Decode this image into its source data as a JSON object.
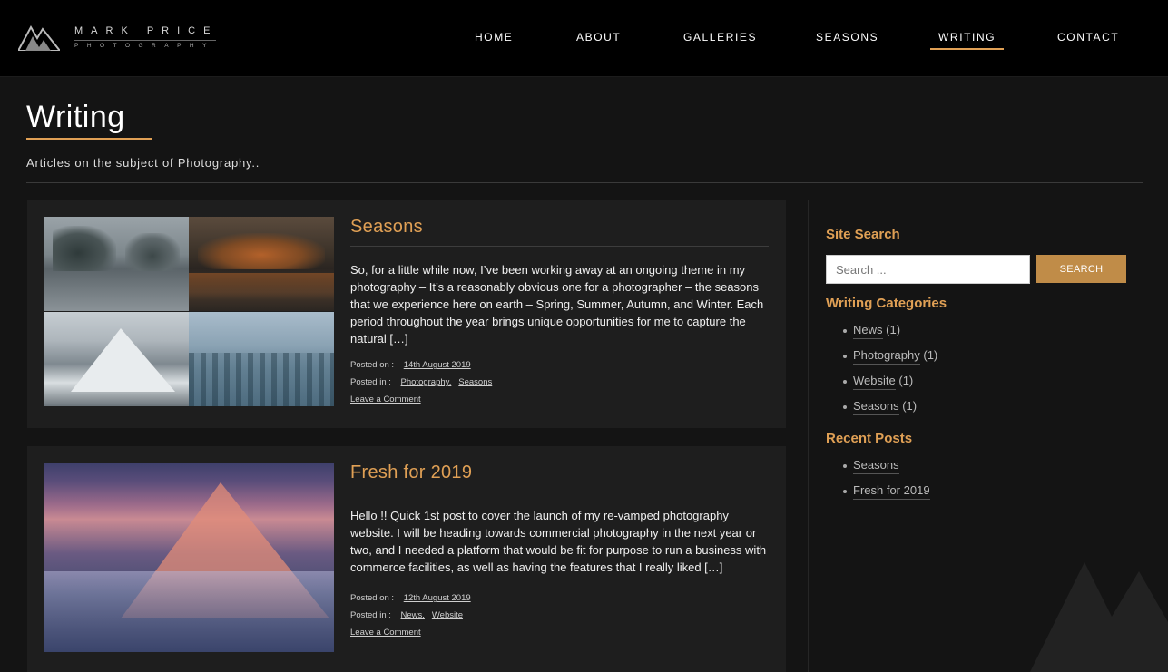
{
  "brand": {
    "name_line1": "MARK PRICE",
    "name_line2": "PHOTOGRAPHY"
  },
  "nav": {
    "items": [
      {
        "label": "HOME"
      },
      {
        "label": "ABOUT"
      },
      {
        "label": "GALLERIES"
      },
      {
        "label": "SEASONS"
      },
      {
        "label": "WRITING"
      },
      {
        "label": "CONTACT"
      }
    ],
    "active": "WRITING"
  },
  "page": {
    "title": "Writing",
    "subtitle": "Articles on the subject of Photography.."
  },
  "posts": [
    {
      "title": "Seasons",
      "excerpt": "So, for a little while now, I’ve been working away at an ongoing theme in my photography – It’s a reasonably obvious one for a photographer – the seasons that we experience here on earth – Spring, Summer, Autumn, and Winter. Each period throughout the year brings unique opportunities for me to capture the natural […]",
      "posted_on_label": "Posted on :",
      "date": "14th August 2019",
      "posted_in_label": "Posted in :",
      "categories": [
        "Photography,",
        "Seasons"
      ],
      "comment_link": "Leave a Comment"
    },
    {
      "title": "Fresh for 2019",
      "excerpt": "Hello !! Quick 1st post to cover the launch of my re-vamped photography website. I will be heading towards commercial photography in the next year or two, and I needed a platform that would be fit for purpose to run a business with commerce facilities, as well as having the features that I really liked […]",
      "posted_on_label": "Posted on :",
      "date": "12th August 2019",
      "posted_in_label": "Posted in :",
      "categories": [
        "News,",
        "Website"
      ],
      "comment_link": "Leave a Comment"
    }
  ],
  "sidebar": {
    "search_title": "Site Search",
    "search_placeholder": "Search ...",
    "search_button": "SEARCH",
    "categories_title": "Writing Categories",
    "categories": [
      {
        "name": "News",
        "count": "(1)"
      },
      {
        "name": "Photography",
        "count": "(1)"
      },
      {
        "name": "Website",
        "count": "(1)"
      },
      {
        "name": "Seasons",
        "count": "(1)"
      }
    ],
    "recent_title": "Recent Posts",
    "recent": [
      "Seasons",
      "Fresh for 2019"
    ]
  },
  "colors": {
    "accent": "#e0a055",
    "button": "#c08c48",
    "header_bg": "#000000",
    "page_bg": "#141414",
    "card_bg": "#1e1e1e"
  }
}
